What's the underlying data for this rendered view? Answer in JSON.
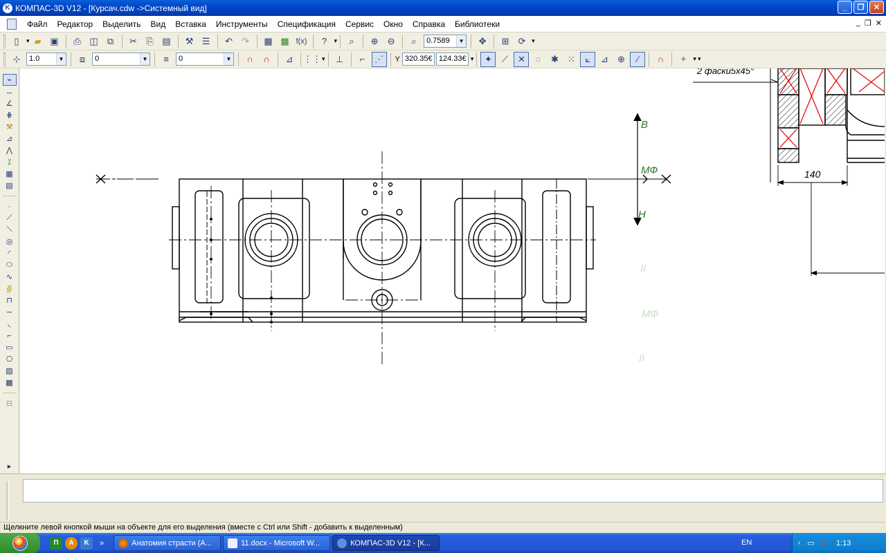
{
  "window": {
    "title": "КОМПАС-3D V12 - [Курсач.cdw ->Системный вид]",
    "app_icon_letter": "K"
  },
  "menu": [
    "Файл",
    "Редактор",
    "Выделить",
    "Вид",
    "Вставка",
    "Инструменты",
    "Спецификация",
    "Сервис",
    "Окно",
    "Справка",
    "Библиотеки"
  ],
  "toolbar1": {
    "zoom_value": "0.7589"
  },
  "toolbar2": {
    "step_value": "1.0",
    "layer_value": "0",
    "style_value": "0",
    "coord_label": "Y",
    "coord_x": "320.35€",
    "coord_y": "124.33€"
  },
  "drawing": {
    "section_top_label": "В",
    "section_mid_label": "МФ",
    "section_bottom_label": "Н",
    "ghost_labels": [
      "II",
      "МФ",
      "II"
    ],
    "chamfer_note": "2 фаски5х45°",
    "dimension_140": "140"
  },
  "status": {
    "hint": "Щелкните левой кнопкой мыши на объекте для его выделения (вместе с Ctrl или Shift - добавить к выделенным)"
  },
  "taskbar": {
    "tasks": [
      "Анатомия страсти (А...",
      "11.docx - Microsoft W...",
      "КОМПАС-3D V12 - [К..."
    ],
    "lang": "EN",
    "clock": "1:13"
  },
  "colors": {
    "titlebar": "#0046c8",
    "taskbar": "#245edb",
    "hatch_red": "#e00000",
    "label_green": "#2a7a2a"
  }
}
